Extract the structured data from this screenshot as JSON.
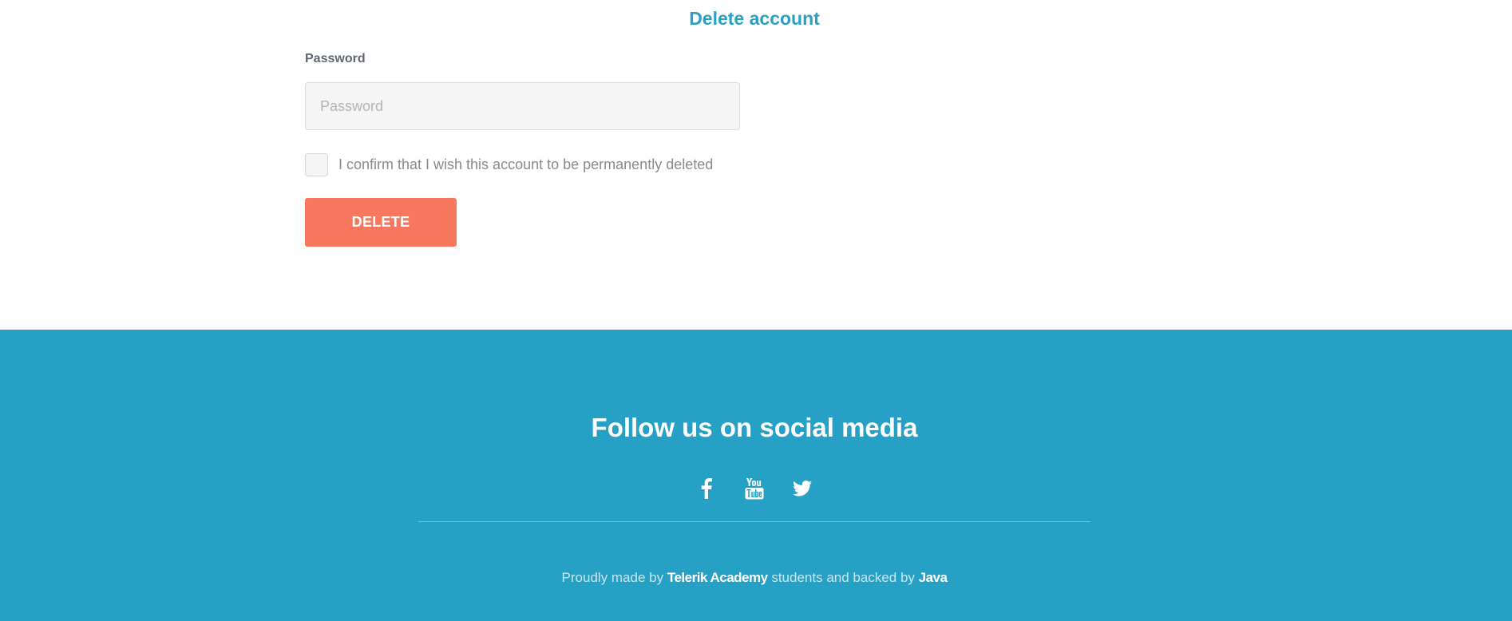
{
  "delete_section": {
    "title": "Delete account",
    "password_label": "Password",
    "password_placeholder": "Password",
    "password_value": "",
    "confirm_label": "I confirm that I wish this account to be permanently deleted",
    "confirm_checked": false,
    "delete_button_label": "DELETE",
    "colors": {
      "title": "#2aa0c3",
      "delete_button": "#f7775f"
    }
  },
  "footer": {
    "title": "Follow us on social media",
    "social": [
      {
        "icon": "facebook-icon"
      },
      {
        "icon": "youtube-icon"
      },
      {
        "icon": "twitter-icon"
      }
    ],
    "credits": {
      "prefix": "Proudly made by",
      "org": "Telerik Academy",
      "middle": "students and backed by",
      "backer": "Java"
    },
    "colors": {
      "background": "#26a1c5"
    }
  }
}
